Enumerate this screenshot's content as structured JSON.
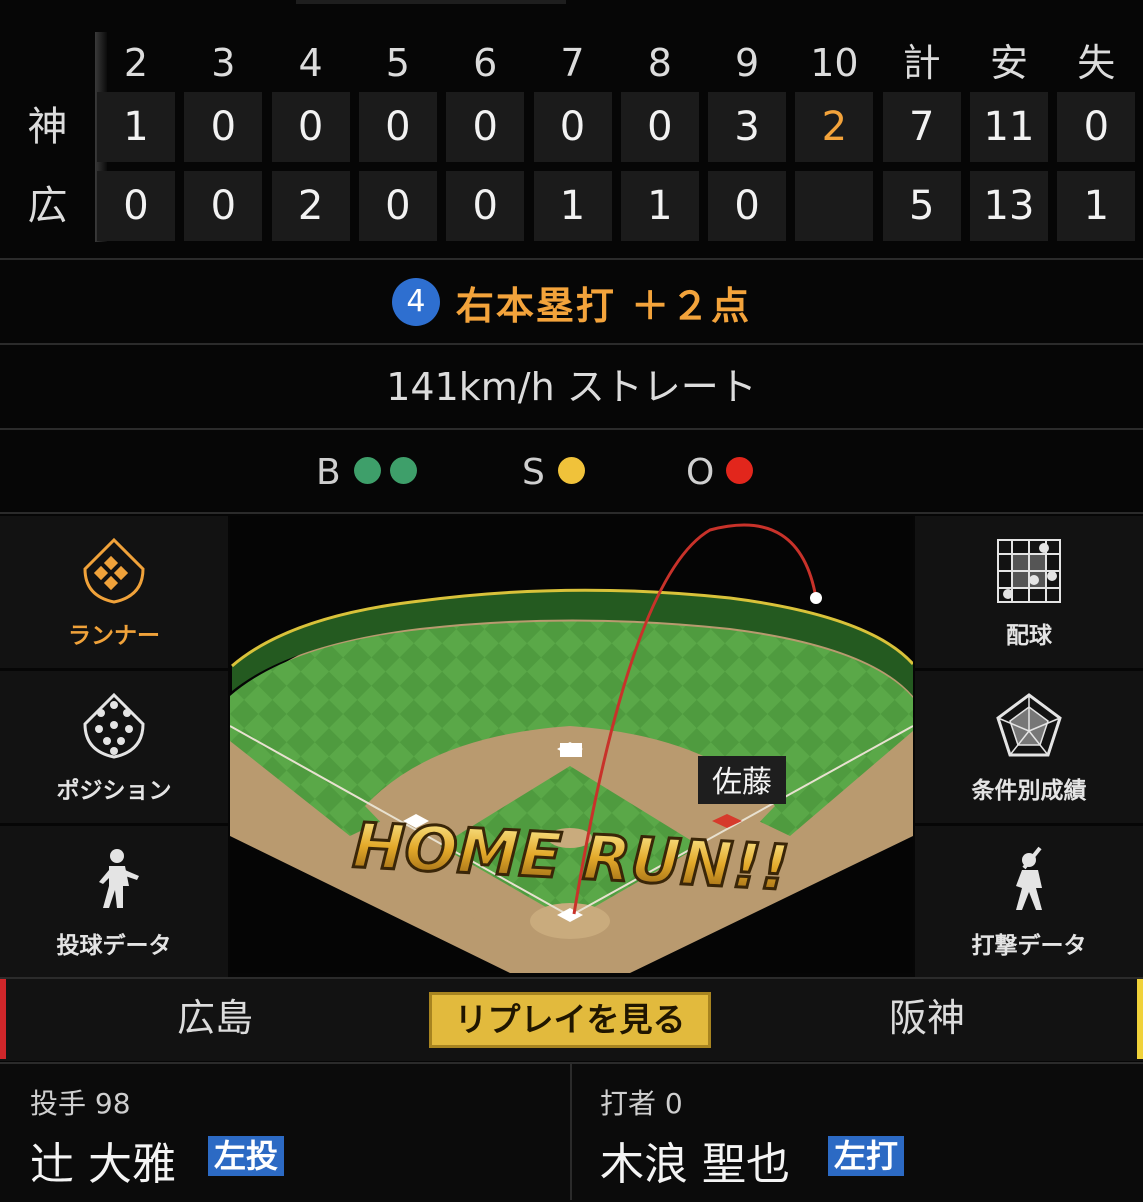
{
  "scoreboard": {
    "innings": [
      "2",
      "3",
      "4",
      "5",
      "6",
      "7",
      "8",
      "9",
      "10",
      "計",
      "安",
      "失"
    ],
    "teams": [
      {
        "name": "神",
        "cells": [
          "1",
          "0",
          "0",
          "0",
          "0",
          "0",
          "0",
          "3",
          "2",
          "7",
          "11",
          "0"
        ]
      },
      {
        "name": "広",
        "cells": [
          "0",
          "0",
          "2",
          "0",
          "0",
          "1",
          "1",
          "0",
          "",
          "5",
          "13",
          "1"
        ]
      }
    ],
    "highlight_color": "#f3a33b"
  },
  "play": {
    "number": "4",
    "text": "右本塁打 ＋２点"
  },
  "pitch": {
    "text": "141km/h ストレート"
  },
  "count": {
    "balls": {
      "label": "B",
      "count": 2,
      "color": "#3e9f6a"
    },
    "strikes": {
      "label": "S",
      "count": 1,
      "color": "#f0c23a"
    },
    "outs": {
      "label": "O",
      "count": 1,
      "color": "#e2261c"
    }
  },
  "left_buttons": [
    {
      "label": "ランナー",
      "icon": "runner-diamond-icon",
      "active": true
    },
    {
      "label": "ポジション",
      "icon": "position-icon",
      "active": false
    },
    {
      "label": "投球データ",
      "icon": "pitcher-icon",
      "active": false
    }
  ],
  "right_buttons": [
    {
      "label": "配球",
      "icon": "pitch-grid-icon"
    },
    {
      "label": "条件別成績",
      "icon": "radar-chart-icon"
    },
    {
      "label": "打撃データ",
      "icon": "batter-icon"
    }
  ],
  "field": {
    "fielder_label": "佐藤",
    "banner": "HOME RUN!!"
  },
  "tabs": {
    "left": "広島",
    "center": "リプレイを見る",
    "right": "阪神"
  },
  "pitcher": {
    "role": "投手 98",
    "name": "辻 大雅",
    "hand": "左投"
  },
  "batter": {
    "role": "打者 0",
    "name": "木浪 聖也",
    "hand": "左打"
  }
}
